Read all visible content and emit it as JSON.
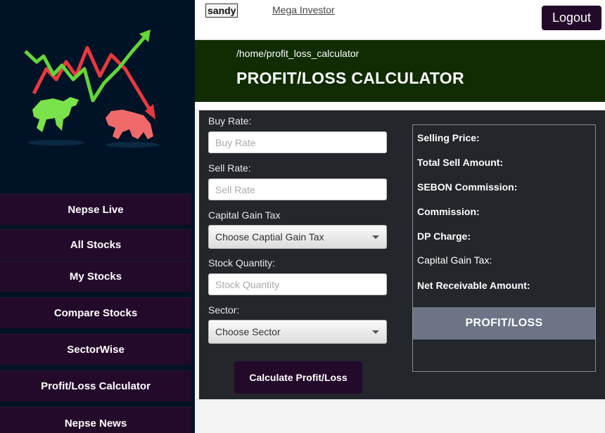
{
  "sidebar": {
    "logo_icon": "bull-bear-market-logo",
    "items": [
      {
        "label": "Nepse Live"
      },
      {
        "label": "All Stocks"
      },
      {
        "label": "My Stocks"
      },
      {
        "label": "Compare Stocks"
      },
      {
        "label": "SectorWise"
      },
      {
        "label": "Profit/Loss Calculator"
      },
      {
        "label": "Nepse News"
      }
    ]
  },
  "topbar": {
    "username": "sandy",
    "mega_investor_link": "Mega Investor",
    "logout_label": "Logout"
  },
  "header": {
    "path": "/home/profit_loss_calculator",
    "title": "PROFIT/LOSS CALCULATOR"
  },
  "form": {
    "buy_rate": {
      "label": "Buy Rate:",
      "placeholder": "Buy Rate",
      "value": ""
    },
    "sell_rate": {
      "label": "Sell Rate:",
      "placeholder": "Sell Rate",
      "value": ""
    },
    "capital_gain_tax": {
      "label": "Capital Gain Tax",
      "selected": "Choose Captial Gain Tax"
    },
    "stock_quantity": {
      "label": "Stock Quantity:",
      "placeholder": "Stock Quantity",
      "value": ""
    },
    "sector": {
      "label": "Sector:",
      "selected": "Choose Sector"
    },
    "calculate_label": "Calculate Profit/Loss"
  },
  "results": {
    "selling_price": "Selling Price:",
    "total_sell_amount": "Total Sell Amount:",
    "sebon_commission": "SEBON Commission:",
    "commission": "Commission:",
    "dp_charge": "DP Charge:",
    "capital_gain_tax": "Capital Gain Tax:",
    "net_receivable": "Net Receivable Amount:",
    "profit_loss": "PROFIT/LOSS"
  },
  "colors": {
    "sidebar_bg": "#001226",
    "accent_purple": "#230a2a",
    "banner_green": "#102c00",
    "panel_bg": "#23262b",
    "profit_loss_bar": "#6c7486"
  }
}
